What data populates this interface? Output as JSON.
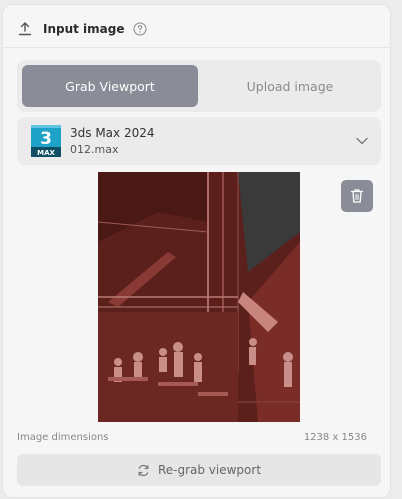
{
  "header": {
    "title": "Input image"
  },
  "tabs": [
    {
      "label": "Grab Viewport",
      "active": true
    },
    {
      "label": "Upload image",
      "active": false
    }
  ],
  "app": {
    "icon_text": "3",
    "icon_sub": "MAX",
    "name": "3ds Max 2024",
    "file": "012.max"
  },
  "image": {
    "dims_label": "Image dimensions",
    "dims_value": "1238 x 1536"
  },
  "actions": {
    "regrab_label": "Re-grab viewport"
  },
  "colors": {
    "accent": "#8a8d98",
    "render_tint": "#a03a33",
    "app_blue": "#1fa2c8"
  }
}
